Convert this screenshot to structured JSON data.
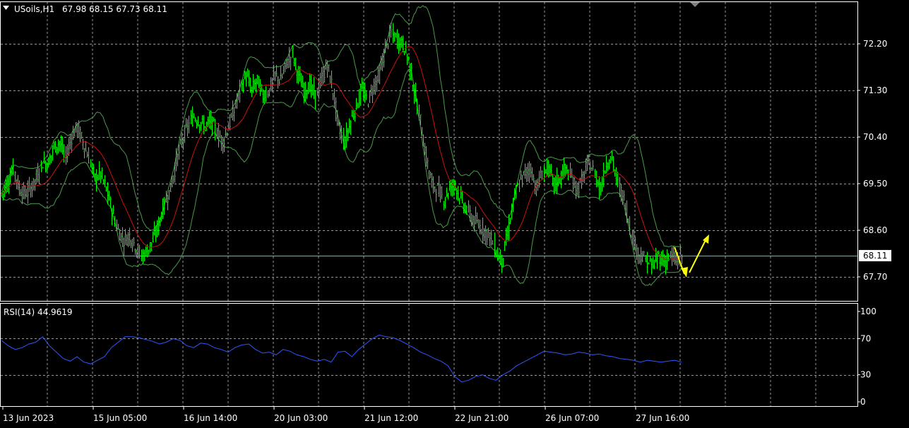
{
  "header": {
    "symbol": "USoils,H1",
    "ohlc": "67.98 68.15 67.73 68.11"
  },
  "rsi_panel": {
    "label": "RSI(14) 44.9619"
  },
  "colors": {
    "background": "#000000",
    "grid": "#c8c8c8",
    "candle": "#00ff00",
    "bands": "#4a9a4a",
    "ma": "#cc1111",
    "rsi": "#3355ff",
    "arrow": "#ffff00",
    "axis_text": "#ffffff"
  },
  "chart_data": [
    {
      "type": "candlestick",
      "symbol": "USoils",
      "timeframe": "H1",
      "ylim": [
        67.2,
        73.0
      ],
      "y_ticks": [
        "72.20",
        "71.30",
        "70.40",
        "69.50",
        "68.60",
        "67.70"
      ],
      "current_price": "68.11",
      "x_ticks": [
        "13 Jun 2023",
        "15 Jun 05:00",
        "16 Jun 14:00",
        "20 Jun 03:00",
        "21 Jun 12:00",
        "22 Jun 21:00",
        "26 Jun 07:00",
        "27 Jun 16:00"
      ],
      "overlays": [
        "Bollinger Bands",
        "Moving Average"
      ],
      "price_path": [
        [
          0,
          69.3
        ],
        [
          4,
          69.5
        ],
        [
          8,
          69.8
        ],
        [
          12,
          69.4
        ],
        [
          16,
          69.3
        ],
        [
          20,
          69.4
        ],
        [
          24,
          69.6
        ],
        [
          28,
          69.9
        ],
        [
          32,
          69.9
        ],
        [
          36,
          70.2
        ],
        [
          40,
          70.3
        ],
        [
          44,
          70.0
        ],
        [
          48,
          70.4
        ],
        [
          52,
          70.6
        ],
        [
          56,
          70.3
        ],
        [
          60,
          70.0
        ],
        [
          64,
          69.6
        ],
        [
          68,
          69.7
        ],
        [
          72,
          69.4
        ],
        [
          76,
          69.0
        ],
        [
          80,
          68.6
        ],
        [
          84,
          68.4
        ],
        [
          88,
          68.5
        ],
        [
          92,
          68.3
        ],
        [
          96,
          68.1
        ],
        [
          100,
          68.2
        ],
        [
          104,
          68.4
        ],
        [
          108,
          68.7
        ],
        [
          112,
          69.1
        ],
        [
          116,
          69.4
        ],
        [
          120,
          69.9
        ],
        [
          124,
          70.3
        ],
        [
          128,
          70.6
        ],
        [
          132,
          70.8
        ],
        [
          136,
          70.7
        ],
        [
          140,
          70.6
        ],
        [
          144,
          70.7
        ],
        [
          148,
          70.5
        ],
        [
          152,
          70.3
        ],
        [
          156,
          70.6
        ],
        [
          160,
          70.9
        ],
        [
          164,
          71.3
        ],
        [
          168,
          71.6
        ],
        [
          172,
          71.3
        ],
        [
          176,
          71.5
        ],
        [
          180,
          71.2
        ],
        [
          184,
          71.3
        ],
        [
          188,
          71.6
        ],
        [
          192,
          71.5
        ],
        [
          196,
          71.8
        ],
        [
          200,
          72.0
        ],
        [
          204,
          71.6
        ],
        [
          208,
          71.3
        ],
        [
          212,
          71.4
        ],
        [
          216,
          71.2
        ],
        [
          220,
          71.5
        ],
        [
          224,
          71.8
        ],
        [
          228,
          71.3
        ],
        [
          232,
          70.6
        ],
        [
          236,
          70.3
        ],
        [
          240,
          70.7
        ],
        [
          244,
          71.0
        ],
        [
          248,
          71.3
        ],
        [
          252,
          71.1
        ],
        [
          256,
          71.4
        ],
        [
          260,
          71.6
        ],
        [
          264,
          72.1
        ],
        [
          268,
          72.4
        ],
        [
          272,
          72.3
        ],
        [
          276,
          72.2
        ],
        [
          280,
          71.9
        ],
        [
          284,
          71.3
        ],
        [
          288,
          70.7
        ],
        [
          292,
          70.0
        ],
        [
          296,
          69.5
        ],
        [
          300,
          69.4
        ],
        [
          304,
          69.2
        ],
        [
          308,
          69.4
        ],
        [
          312,
          69.5
        ],
        [
          316,
          69.2
        ],
        [
          320,
          69.0
        ],
        [
          324,
          68.8
        ],
        [
          328,
          68.7
        ],
        [
          332,
          68.6
        ],
        [
          336,
          68.5
        ],
        [
          340,
          68.2
        ],
        [
          344,
          68.0
        ],
        [
          348,
          68.5
        ],
        [
          352,
          69.1
        ],
        [
          356,
          69.5
        ],
        [
          360,
          69.7
        ],
        [
          364,
          69.8
        ],
        [
          368,
          69.4
        ],
        [
          372,
          69.7
        ],
        [
          376,
          69.8
        ],
        [
          380,
          69.5
        ],
        [
          384,
          69.6
        ],
        [
          388,
          69.8
        ],
        [
          392,
          69.6
        ],
        [
          396,
          69.4
        ],
        [
          400,
          69.6
        ],
        [
          404,
          69.9
        ],
        [
          408,
          69.7
        ],
        [
          412,
          69.4
        ],
        [
          416,
          69.9
        ],
        [
          420,
          70.0
        ],
        [
          424,
          69.5
        ],
        [
          428,
          69.2
        ],
        [
          432,
          68.7
        ],
        [
          436,
          68.3
        ],
        [
          440,
          68.1
        ],
        [
          444,
          68.0
        ],
        [
          448,
          67.9
        ],
        [
          452,
          68.1
        ],
        [
          456,
          68.0
        ],
        [
          460,
          68.1
        ],
        [
          464,
          68.0
        ],
        [
          468,
          68.1
        ]
      ]
    },
    {
      "type": "line",
      "name": "RSI(14)",
      "value": "44.9619",
      "ylim": [
        0,
        100
      ],
      "y_ticks": [
        "100",
        "70",
        "30",
        "0"
      ],
      "values": [
        68,
        62,
        58,
        60,
        64,
        66,
        72,
        62,
        55,
        48,
        45,
        50,
        44,
        42,
        46,
        50,
        60,
        66,
        72,
        72,
        71,
        69,
        67,
        64,
        66,
        70,
        68,
        62,
        60,
        65,
        64,
        60,
        58,
        55,
        60,
        63,
        64,
        58,
        54,
        55,
        52,
        58,
        56,
        52,
        50,
        47,
        45,
        47,
        44,
        55,
        56,
        50,
        58,
        64,
        70,
        74,
        72,
        71,
        68,
        64,
        60,
        55,
        52,
        48,
        45,
        40,
        28,
        22,
        24,
        28,
        30,
        26,
        24,
        30,
        34,
        40,
        44,
        48,
        52,
        56,
        55,
        54,
        52,
        53,
        55,
        54,
        52,
        53,
        51,
        50,
        48,
        47,
        46,
        44,
        46,
        45,
        44,
        45,
        46,
        44
      ]
    }
  ]
}
